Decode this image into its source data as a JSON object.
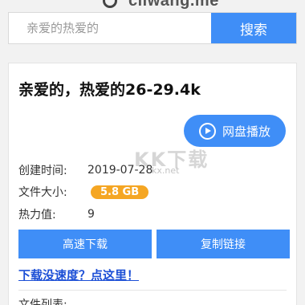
{
  "header": {
    "site_logo_text": "cliwang.me"
  },
  "search": {
    "placeholder": "亲爱的热爱的",
    "button_label": "搜索"
  },
  "card": {
    "title": "亲爱的，热爱的26-29.4k",
    "play_button_label": "网盘播放",
    "watermark": "KK下载",
    "watermark_small": "kx.net",
    "info": {
      "created_label": "创建时间:",
      "created_value": "2019-07-28",
      "size_label": "文件大小:",
      "size_value": "5.8 GB",
      "heat_label": "热力值:",
      "heat_value": "9"
    },
    "buttons": {
      "fast_download": "高速下载",
      "copy_link": "复制链接"
    },
    "slow_link": "下载没速度？点这里！",
    "file_list_label": "文件列表:"
  },
  "colors": {
    "accent": "#3f8ef7",
    "badge": "#f5a623",
    "link": "#1c4fd6"
  },
  "icons": {
    "play": "play-circle-icon",
    "logo": "site-logo-icon"
  }
}
